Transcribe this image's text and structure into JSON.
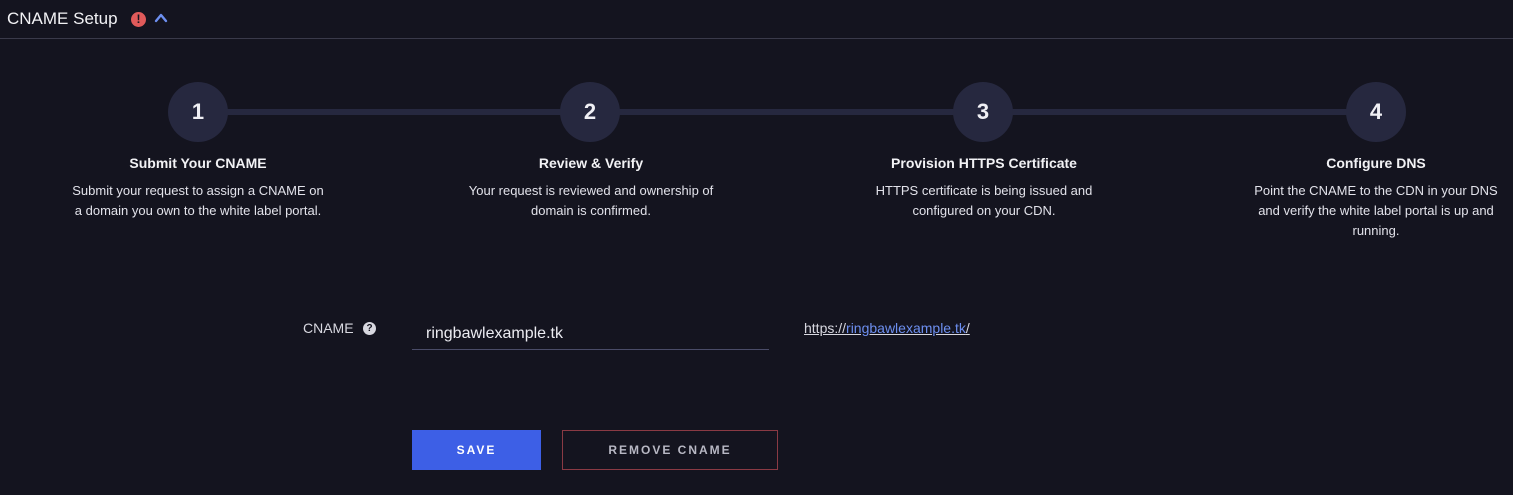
{
  "header": {
    "title": "CNAME Setup",
    "alert_icon": "exclamation-circle-icon",
    "alert_color": "#e05a5a",
    "collapse_icon": "chevron-up-icon",
    "collapse_color": "#6d8ff0"
  },
  "steps": [
    {
      "number": "1",
      "title": "Submit Your CNAME",
      "description": "Submit your request to assign a CNAME on a domain you own to the white label portal."
    },
    {
      "number": "2",
      "title": "Review & Verify",
      "description": "Your request is reviewed and ownership of domain is confirmed."
    },
    {
      "number": "3",
      "title": "Provision HTTPS Certificate",
      "description": "HTTPS certificate is being issued and configured on your CDN."
    },
    {
      "number": "4",
      "title": "Configure DNS",
      "description": "Point the CNAME to the CDN in your DNS and verify the white label portal is up and running."
    }
  ],
  "form": {
    "cname_label": "CNAME",
    "help_icon": "question-circle-icon",
    "cname_value": "ringbawlexample.tk",
    "url_prefix": "https://",
    "url_host": "ringbawlexample.tk",
    "url_suffix": "/"
  },
  "actions": {
    "save_label": "SAVE",
    "remove_label": "REMOVE CNAME",
    "accent_color": "#3d5fe6",
    "danger_border_color": "#8a3a44"
  }
}
